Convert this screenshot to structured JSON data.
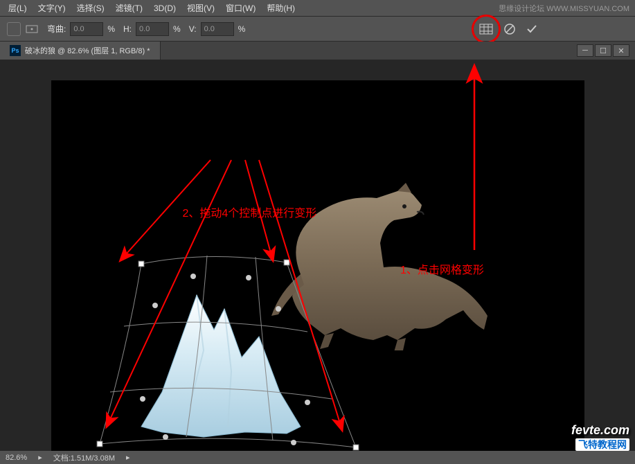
{
  "menubar": {
    "items": [
      "层(L)",
      "文字(Y)",
      "选择(S)",
      "滤镜(T)",
      "3D(D)",
      "视图(V)",
      "窗口(W)",
      "帮助(H)"
    ]
  },
  "optionsbar": {
    "bend_label": "弯曲:",
    "bend_value": "0.0",
    "h_label": "H:",
    "h_value": "0.0",
    "v_label": "V:",
    "v_value": "0.0",
    "percent": "%"
  },
  "document": {
    "tab_title": "破冰的狼 @ 82.6% (图层 1, RGB/8) *",
    "ps": "Ps"
  },
  "annotations": {
    "a1": "1、点击网格变形",
    "a2": "2、拖动4个控制点进行变形"
  },
  "statusbar": {
    "zoom": "82.6%",
    "doc": "文档:1.51M/3.08M"
  },
  "watermark": {
    "top": "思缘设计论坛 WWW.MISSYUAN.COM",
    "site": "fevte.com",
    "cn": "飞特教程网"
  },
  "win": {
    "min": "─",
    "max": "☐",
    "close": "✕"
  }
}
